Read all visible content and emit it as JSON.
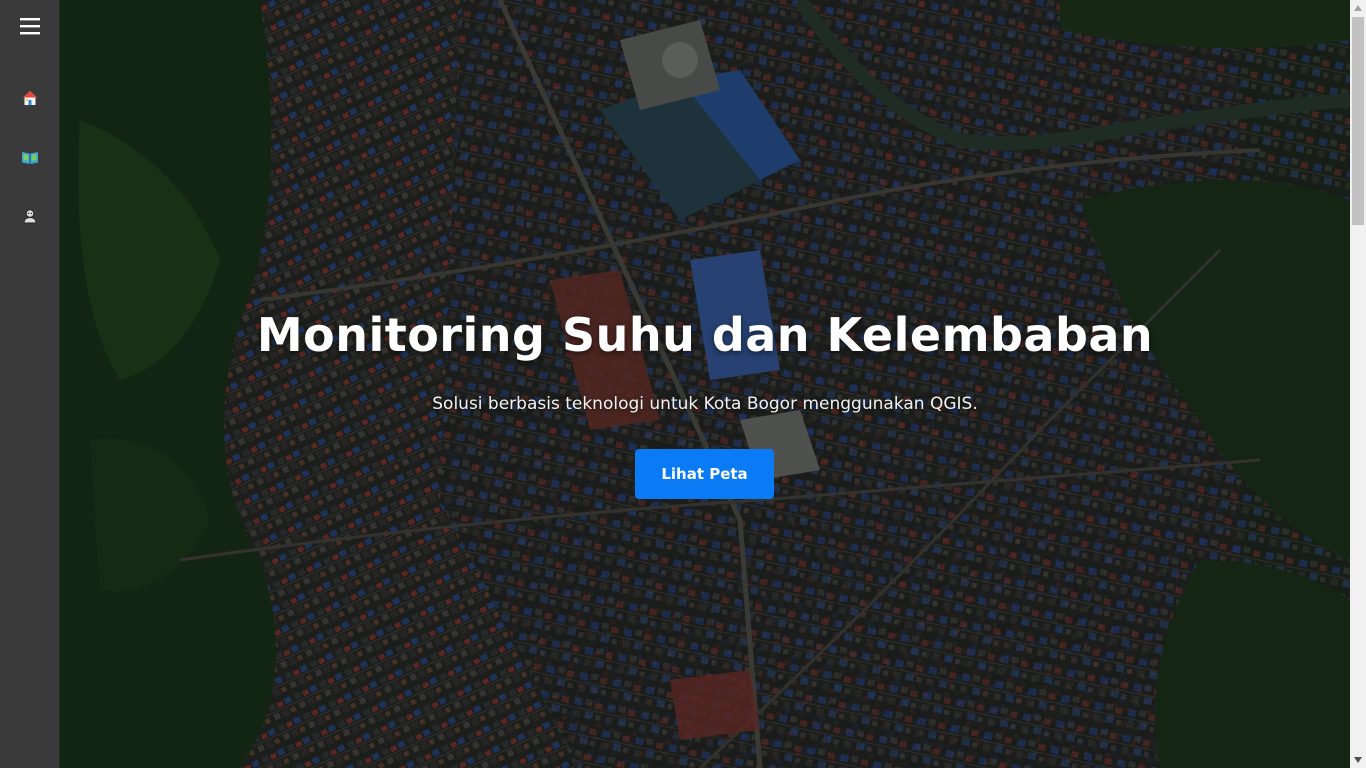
{
  "sidebar": {
    "menu_icon": "hamburger-menu-icon",
    "items": [
      {
        "icon": "home-icon",
        "label": ""
      },
      {
        "icon": "map-book-icon",
        "label": ""
      },
      {
        "icon": "user-icon",
        "label": ""
      }
    ]
  },
  "hero": {
    "title": "Monitoring Suhu dan Kelembaban",
    "subtitle": "Solusi berbasis teknologi untuk Kota Bogor menggunakan QGIS.",
    "cta_label": "Lihat Peta",
    "background": "satellite-city-image"
  },
  "colors": {
    "sidebar_bg": "#3a3a3a",
    "accent": "#0a7bf5",
    "title_text": "#ffffff"
  }
}
